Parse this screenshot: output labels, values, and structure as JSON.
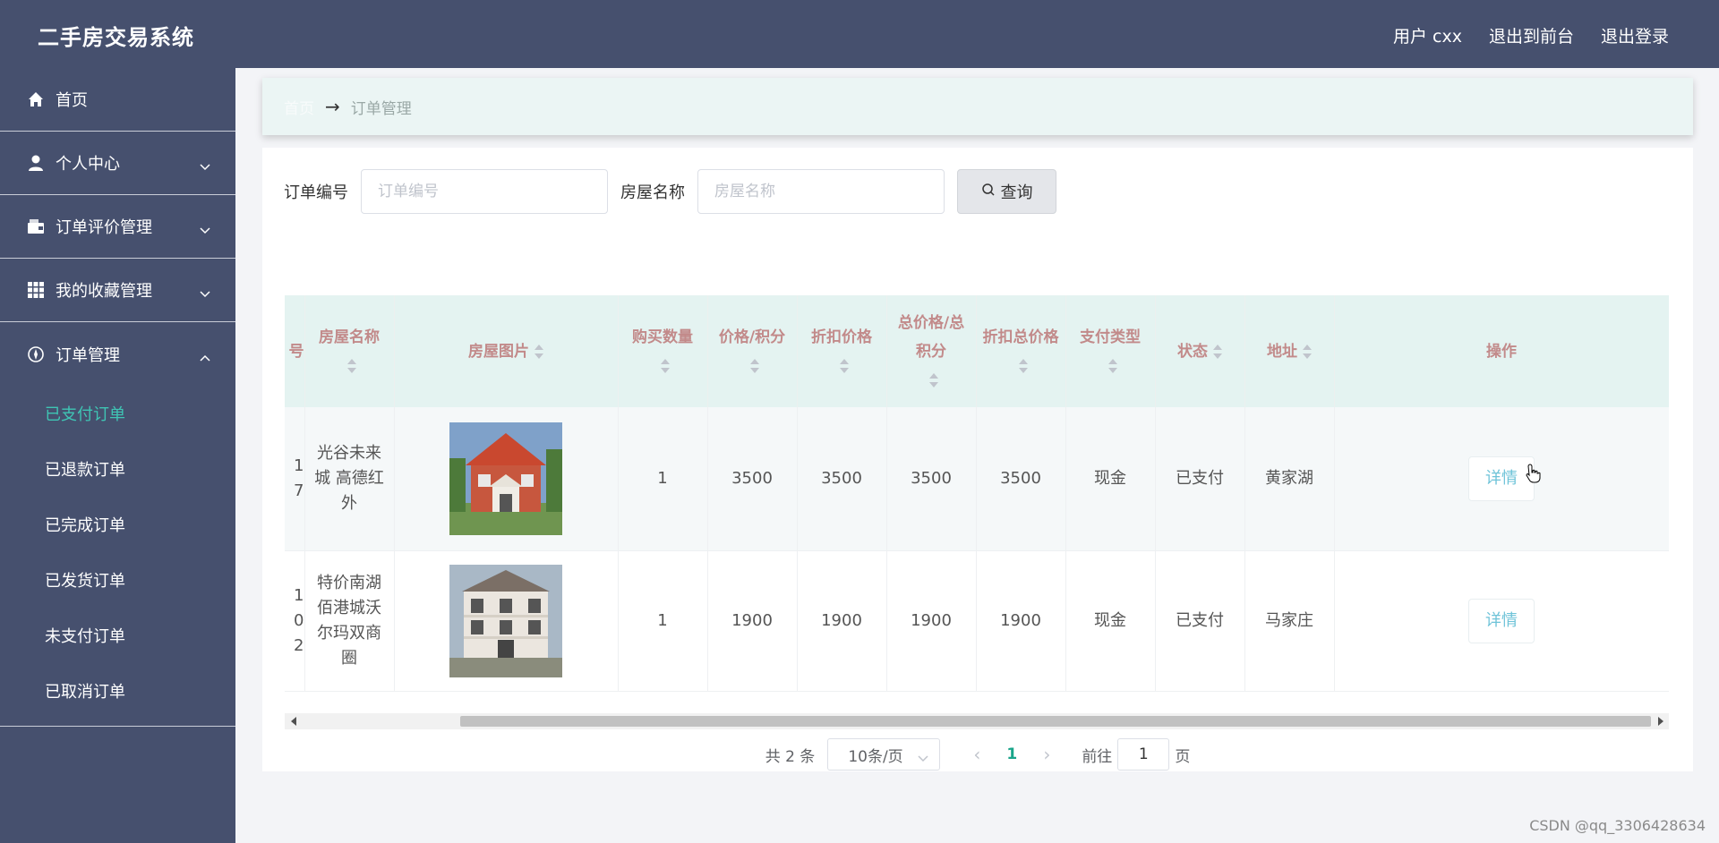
{
  "app": {
    "title": "二手房交易系统",
    "nav": [
      "用户 cxx",
      "退出到前台",
      "退出登录"
    ]
  },
  "sidebar": {
    "items": [
      {
        "label": "首页",
        "icon": "home-icon"
      },
      {
        "label": "个人中心",
        "icon": "user-icon"
      },
      {
        "label": "订单评价管理",
        "icon": "wallet-icon"
      },
      {
        "label": "我的收藏管理",
        "icon": "grid-icon"
      },
      {
        "label": "订单管理",
        "icon": "compass-icon"
      }
    ],
    "submenu": [
      "已支付订单",
      "已退款订单",
      "已完成订单",
      "已发货订单",
      "未支付订单",
      "已取消订单"
    ],
    "active_submenu": "已支付订单"
  },
  "breadcrumb": {
    "home": "首页",
    "current": "订单管理"
  },
  "search": {
    "order_no_label": "订单编号",
    "order_no_placeholder": "订单编号",
    "house_name_label": "房屋名称",
    "house_name_placeholder": "房屋名称",
    "button_label": "查询"
  },
  "table": {
    "columns": [
      "号",
      "房屋名称",
      "房屋图片",
      "购买数量",
      "价格/积分",
      "折扣价格",
      "总价格/总积分",
      "折扣总价格",
      "支付类型",
      "状态",
      "地址",
      "操作"
    ],
    "rows": [
      {
        "order_no": "1\n7",
        "house_name": "光谷未来城 高德红外",
        "quantity": "1",
        "price": "3500",
        "discount_price": "3500",
        "total": "3500",
        "discount_total": "3500",
        "pay_type": "现金",
        "status": "已支付",
        "address": "黄家湖",
        "action": "详情"
      },
      {
        "order_no": "1\n0\n2",
        "house_name": "特价南湖佰港城沃尔玛双商圈",
        "quantity": "1",
        "price": "1900",
        "discount_price": "1900",
        "total": "1900",
        "discount_total": "1900",
        "pay_type": "现金",
        "status": "已支付",
        "address": "马家庄",
        "action": "详情"
      }
    ]
  },
  "pagination": {
    "total": "共 2 条",
    "page_size": "10条/页",
    "current": "1",
    "goto_label": "前往",
    "goto_value": "1",
    "page_unit": "页"
  },
  "watermark": "CSDN @qq_3306428634",
  "colors": {
    "header_bg": "#46506e",
    "accent": "#3fc5b4",
    "table_header_text": "#c28a8a"
  }
}
